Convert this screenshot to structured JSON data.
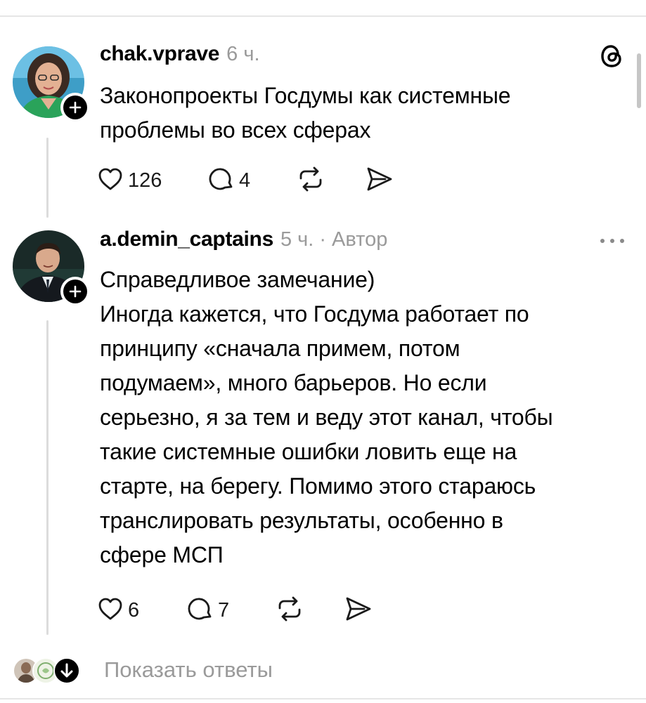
{
  "posts": [
    {
      "username": "chak.vprave",
      "time": "6 ч.",
      "author_tag": "",
      "text_lines": [
        "Законопроекты Госдумы как системные",
        "проблемы во всех сферах"
      ],
      "likes": "126",
      "replies": "4"
    },
    {
      "username": "a.demin_captains",
      "time": "5 ч.",
      "author_tag": "· Автор",
      "text_lines": [
        "Справедливое замечание)",
        "Иногда кажется, что Госдума работает по",
        "принципу «сначала примем, потом",
        "подумаем», много барьеров. Но если",
        "серьезно, я за тем и веду этот канал, чтобы",
        "такие системные ошибки ловить еще на",
        "старте, на берегу. Помимо этого стараюсь",
        "транслировать результаты, особенно в",
        "сфере МСП"
      ],
      "likes": "6",
      "replies": "7"
    }
  ],
  "show_replies_label": "Показать ответы",
  "icons": {
    "like": "heart-icon",
    "reply": "comment-icon",
    "repost": "repost-icon",
    "share": "send-icon",
    "follow": "plus-icon",
    "app": "threads-logo-icon",
    "more": "more-dots-icon",
    "expand": "arrow-down-icon"
  },
  "colors": {
    "text": "#000000",
    "muted": "#9a9a9a",
    "thread_line": "#dcdcdc"
  }
}
